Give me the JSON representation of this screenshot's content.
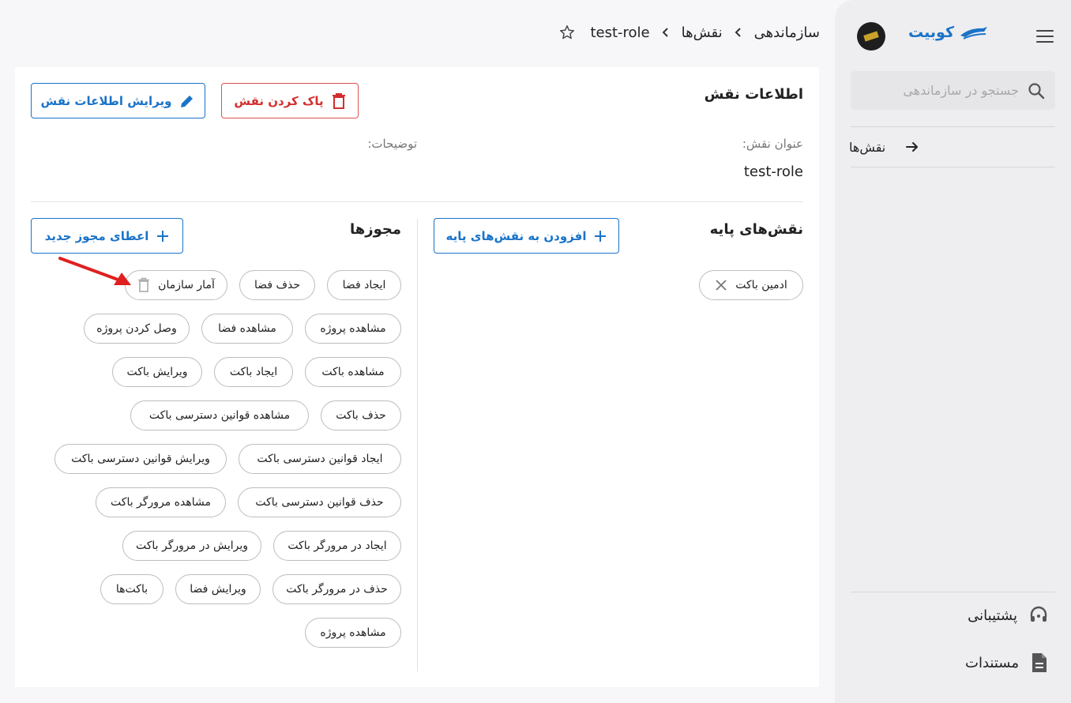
{
  "app": {
    "brand_name": "کوبیت",
    "brand_color": "#1a73c8"
  },
  "breadcrumb": {
    "items": [
      "سازماندهی",
      "نقش‌ها",
      "test-role"
    ],
    "separator": "›"
  },
  "sidebar": {
    "search_placeholder": "جستجو در سازماندهی",
    "nav_items": [
      {
        "label": "نقش‌ها"
      }
    ],
    "bottom_items": [
      {
        "label": "پشتیبانی"
      },
      {
        "label": "مستندات"
      }
    ]
  },
  "role_info": {
    "title": "اطلاعات نقش",
    "delete_label": "پاک کردن نقش",
    "edit_label": "ویرایش اطلاعات نقش",
    "role_title_label": "عنوان نقش:",
    "role_title_value": "test-role",
    "description_label": "توضیحات:"
  },
  "base_roles": {
    "title": "نقش‌های پایه",
    "add_label": "افزودن به نقش‌های پایه",
    "items": [
      "ادمین باکت"
    ]
  },
  "permissions": {
    "title": "مجوزها",
    "add_label": "اعطای مجوز جدید",
    "items": [
      "ایجاد فضا",
      "حذف فضا",
      "آمار سازمان",
      "مشاهده پروژه",
      "مشاهده فضا",
      "وصل کردن پروژه",
      "مشاهده باکت",
      "ایجاد باکت",
      "ویرایش باکت",
      "حذف باکت",
      "مشاهده قوانین دسترسی باکت",
      "ایجاد قوانین دسترسی باکت",
      "ویرایش قوانین دسترسی باکت",
      "حذف قوانین دسترسی باکت",
      "مشاهده مرورگر باکت",
      "ایجاد در مرورگر باکت",
      "ویرایش در مرورگر باکت",
      "حذف در مرورگر باکت",
      "ویرایش فضا",
      "باکت‌ها",
      "مشاهده پروژه"
    ]
  },
  "colors": {
    "primary": "#1a73c8",
    "danger": "#d32f2f",
    "annotation_arrow": "#e02020"
  }
}
